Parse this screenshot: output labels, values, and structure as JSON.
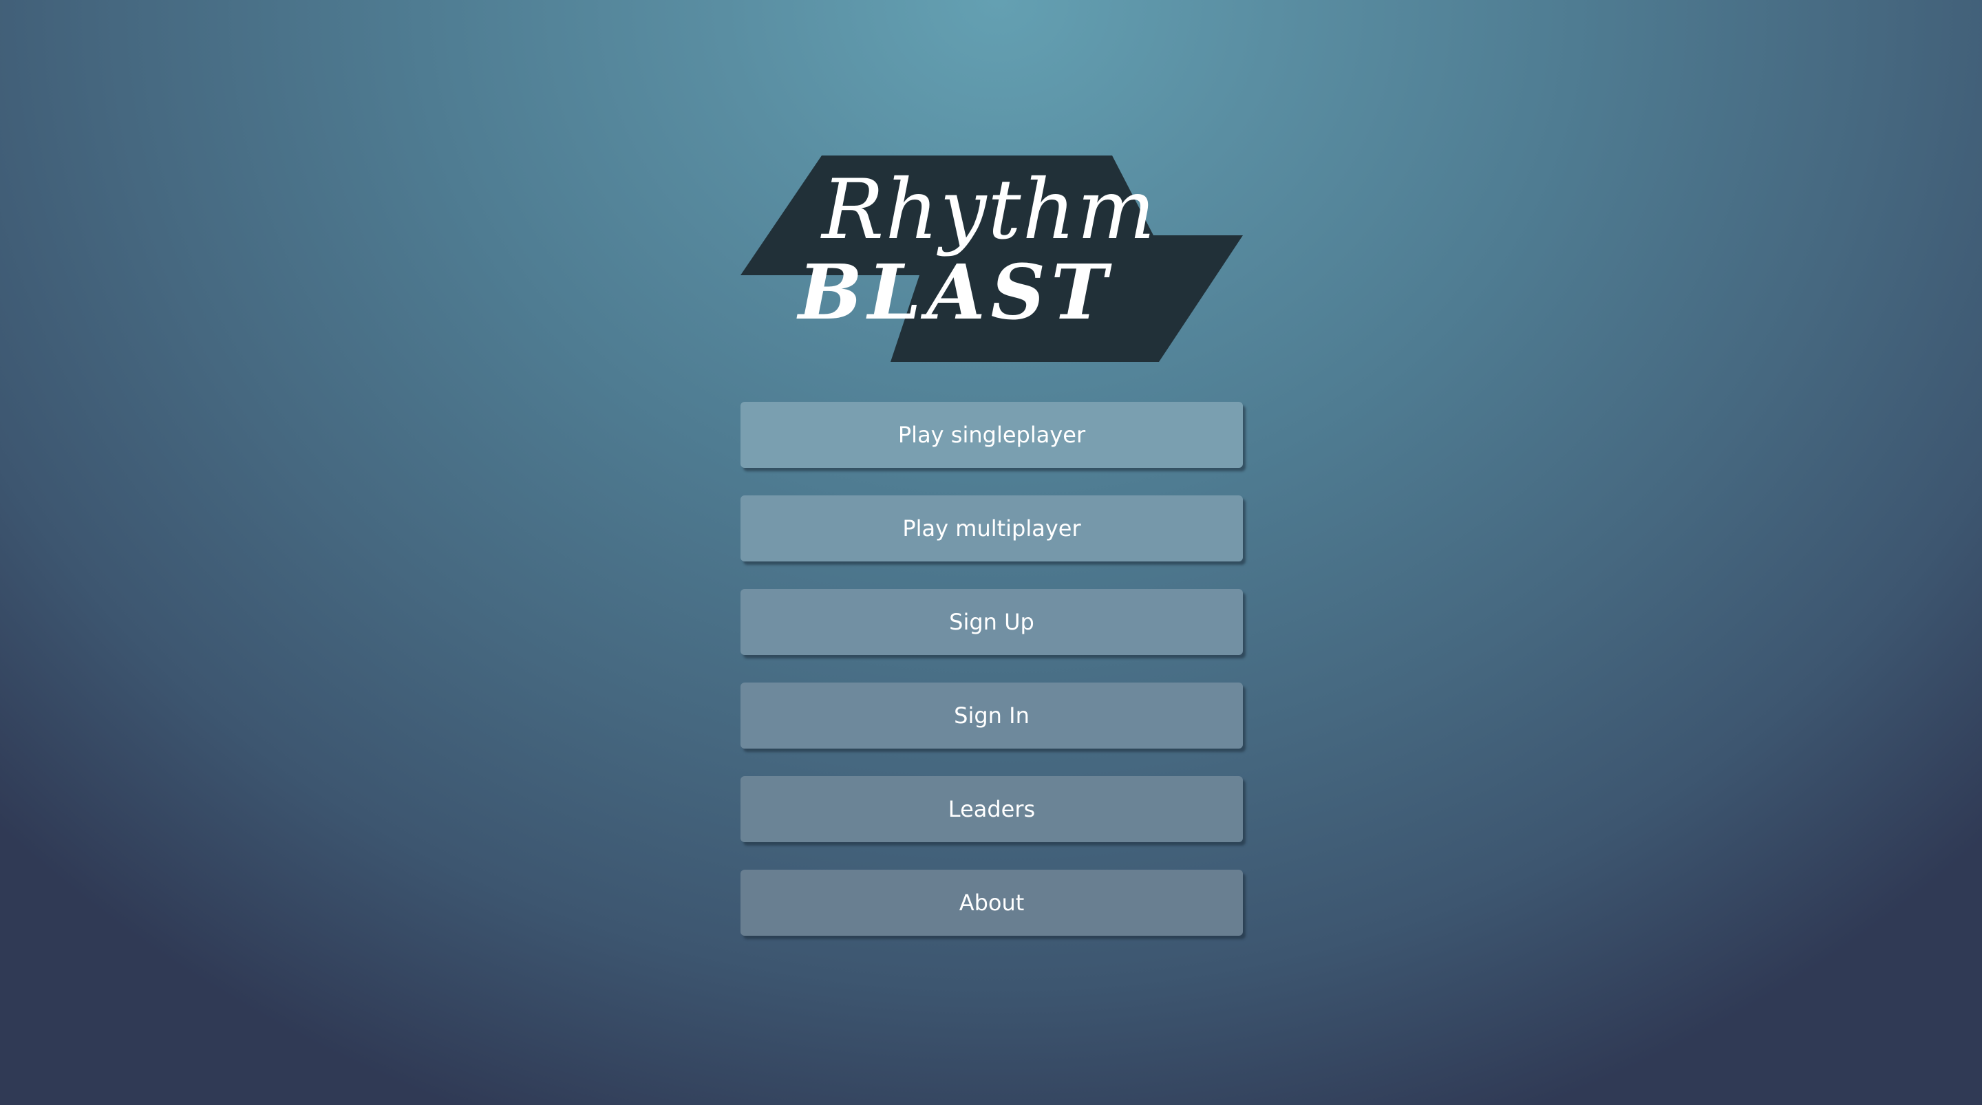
{
  "logo": {
    "line1": "Rhythm",
    "line2": "BLAST"
  },
  "menu": {
    "play_singleplayer": "Play singleplayer",
    "play_multiplayer": "Play multiplayer",
    "sign_up": "Sign Up",
    "sign_in": "Sign In",
    "leaders": "Leaders",
    "about": "About"
  },
  "colors": {
    "logo_shape": "#213038",
    "logo_text": "#ffffff",
    "button_text": "#ffffff",
    "background_light": "#64a0b2",
    "background_dark": "#303a55"
  }
}
